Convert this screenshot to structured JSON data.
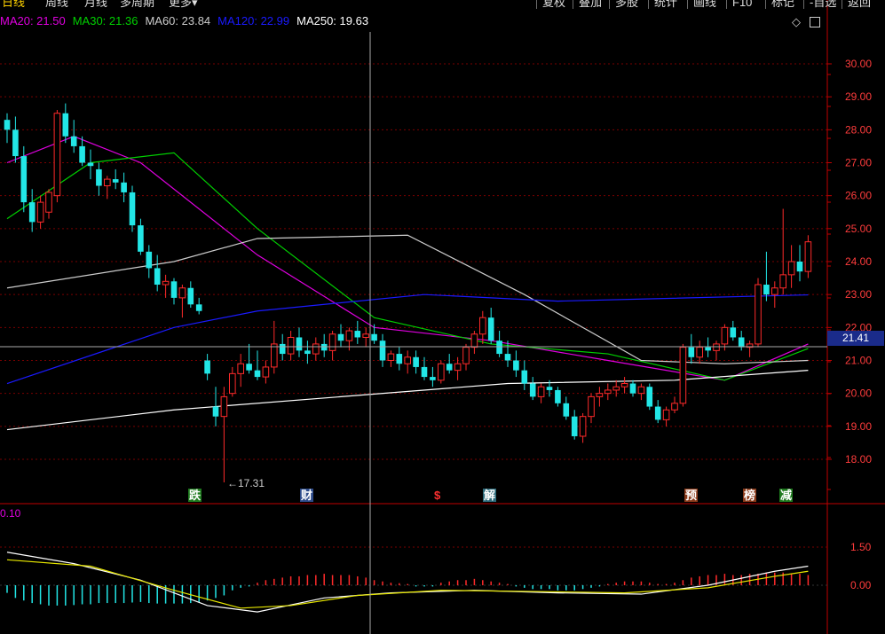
{
  "top_bar": {
    "period_tabs": [
      "日线",
      "周线",
      "月线",
      "多周期",
      "更多▾"
    ],
    "tools": [
      "复权",
      "叠加",
      "多股",
      "统计",
      "画线",
      "F10",
      "标记",
      "-自选",
      "返回"
    ]
  },
  "ma_legend": [
    {
      "label": "MA20: 21.50",
      "color": "#e000e0"
    },
    {
      "label": "MA30: 21.36",
      "color": "#00d000"
    },
    {
      "label": "MA60: 23.84",
      "color": "#cccccc"
    },
    {
      "label": "MA120: 22.99",
      "color": "#1a1aff"
    },
    {
      "label": "MA250: 19.63",
      "color": "#ffffff"
    }
  ],
  "price_axis": [
    "30.00",
    "29.00",
    "28.00",
    "27.00",
    "26.00",
    "25.00",
    "24.00",
    "23.00",
    "22.00",
    "21.00",
    "20.00",
    "19.00",
    "18.00"
  ],
  "crosshair_price": "21.41",
  "low_annotation": "17.31",
  "event_markers": [
    {
      "label": "跌",
      "bg": "#1e7a1e"
    },
    {
      "label": "财",
      "bg": "#2d4b8a"
    },
    {
      "label": "$",
      "bg": "#000000",
      "fg": "#ff3030"
    },
    {
      "label": "解",
      "bg": "#2c6a7a"
    },
    {
      "label": "预",
      "bg": "#8a3a1a"
    },
    {
      "label": "榜",
      "bg": "#8a3a1a"
    },
    {
      "label": "减",
      "bg": "#1e7a1e"
    }
  ],
  "macd_legend": "0.10",
  "macd_axis": [
    "1.50",
    "0.00"
  ],
  "colors": {
    "up": "#ff2a2a",
    "down": "#22e6e6",
    "grid": "#7a0000",
    "axis": "#c00000"
  },
  "chart_data": {
    "type": "candlestick",
    "ylim": [
      17.0,
      31.0
    ],
    "candles": [
      [
        28.3,
        28.5,
        27.6,
        28.0
      ],
      [
        28.0,
        28.4,
        27.0,
        27.2
      ],
      [
        27.2,
        27.5,
        25.5,
        25.8
      ],
      [
        25.8,
        26.2,
        24.9,
        25.2
      ],
      [
        25.2,
        26.0,
        25.0,
        25.8
      ],
      [
        25.5,
        26.2,
        25.3,
        26.1
      ],
      [
        26.0,
        28.6,
        25.8,
        28.5
      ],
      [
        28.5,
        28.8,
        27.6,
        27.8
      ],
      [
        27.8,
        28.3,
        27.3,
        27.5
      ],
      [
        27.5,
        27.8,
        26.9,
        27.0
      ],
      [
        27.0,
        27.4,
        26.5,
        26.9
      ],
      [
        26.8,
        27.0,
        26.0,
        26.3
      ],
      [
        26.3,
        26.6,
        25.9,
        26.5
      ],
      [
        26.5,
        26.8,
        26.2,
        26.4
      ],
      [
        26.4,
        26.7,
        25.8,
        26.1
      ],
      [
        26.1,
        26.3,
        24.9,
        25.1
      ],
      [
        25.1,
        25.3,
        24.2,
        24.3
      ],
      [
        24.3,
        24.5,
        23.5,
        23.8
      ],
      [
        23.8,
        24.2,
        23.1,
        23.3
      ],
      [
        23.3,
        23.6,
        22.9,
        23.4
      ],
      [
        23.4,
        23.5,
        22.7,
        22.9
      ],
      [
        22.9,
        23.3,
        22.3,
        23.2
      ],
      [
        23.2,
        23.4,
        22.6,
        22.7
      ],
      [
        22.7,
        22.9,
        22.4,
        22.5
      ],
      [
        21.0,
        21.2,
        20.4,
        20.6
      ],
      [
        19.6,
        20.2,
        19.0,
        19.3
      ],
      [
        19.3,
        20.2,
        17.3,
        19.9
      ],
      [
        20.0,
        20.8,
        19.9,
        20.6
      ],
      [
        20.6,
        21.2,
        20.2,
        20.9
      ],
      [
        20.9,
        21.5,
        20.6,
        20.7
      ],
      [
        20.7,
        21.3,
        20.4,
        20.5
      ],
      [
        20.5,
        21.0,
        20.3,
        20.8
      ],
      [
        20.8,
        22.2,
        20.6,
        21.5
      ],
      [
        21.5,
        21.8,
        21.0,
        21.2
      ],
      [
        21.2,
        21.9,
        21.0,
        21.7
      ],
      [
        21.7,
        22.0,
        21.1,
        21.3
      ],
      [
        21.3,
        21.6,
        20.9,
        21.2
      ],
      [
        21.2,
        21.7,
        21.0,
        21.5
      ],
      [
        21.5,
        21.8,
        21.1,
        21.3
      ],
      [
        21.3,
        21.9,
        21.0,
        21.8
      ],
      [
        21.8,
        22.1,
        21.4,
        21.6
      ],
      [
        21.6,
        22.0,
        21.3,
        21.9
      ],
      [
        21.9,
        22.2,
        21.5,
        21.7
      ],
      [
        21.7,
        22.0,
        21.4,
        21.8
      ],
      [
        21.8,
        22.1,
        21.5,
        21.6
      ],
      [
        21.6,
        21.8,
        20.8,
        21.0
      ],
      [
        21.0,
        21.3,
        20.8,
        21.2
      ],
      [
        21.2,
        21.4,
        20.7,
        20.9
      ],
      [
        20.9,
        21.3,
        20.6,
        21.1
      ],
      [
        21.1,
        21.3,
        20.6,
        20.8
      ],
      [
        20.8,
        21.1,
        20.4,
        20.5
      ],
      [
        20.5,
        20.8,
        20.2,
        20.4
      ],
      [
        20.4,
        21.0,
        20.3,
        20.9
      ],
      [
        20.9,
        21.2,
        20.6,
        20.7
      ],
      [
        20.7,
        21.1,
        20.4,
        20.9
      ],
      [
        20.9,
        21.5,
        20.7,
        21.4
      ],
      [
        21.4,
        21.9,
        21.2,
        21.8
      ],
      [
        21.8,
        22.5,
        21.5,
        22.3
      ],
      [
        22.3,
        22.6,
        21.5,
        21.6
      ],
      [
        21.6,
        21.9,
        21.1,
        21.2
      ],
      [
        21.2,
        21.6,
        20.8,
        21.0
      ],
      [
        21.0,
        21.3,
        20.5,
        20.7
      ],
      [
        20.7,
        21.0,
        20.1,
        20.3
      ],
      [
        20.3,
        20.5,
        19.8,
        19.9
      ],
      [
        19.9,
        20.3,
        19.7,
        20.2
      ],
      [
        20.2,
        20.4,
        19.9,
        20.1
      ],
      [
        20.1,
        20.2,
        19.6,
        19.7
      ],
      [
        19.7,
        19.9,
        19.2,
        19.3
      ],
      [
        19.3,
        19.5,
        18.6,
        18.7
      ],
      [
        18.7,
        19.4,
        18.5,
        19.3
      ],
      [
        19.3,
        20.0,
        19.1,
        19.9
      ],
      [
        19.9,
        20.2,
        19.6,
        20.0
      ],
      [
        20.0,
        20.3,
        19.8,
        20.1
      ],
      [
        20.1,
        20.4,
        19.9,
        20.2
      ],
      [
        20.2,
        20.5,
        20.0,
        20.3
      ],
      [
        20.3,
        20.4,
        19.9,
        20.0
      ],
      [
        20.0,
        20.3,
        19.8,
        20.2
      ],
      [
        20.2,
        20.3,
        19.5,
        19.6
      ],
      [
        19.6,
        19.8,
        19.1,
        19.2
      ],
      [
        19.2,
        19.6,
        19.0,
        19.5
      ],
      [
        19.5,
        19.9,
        19.4,
        19.7
      ],
      [
        19.7,
        21.5,
        19.6,
        21.4
      ],
      [
        21.4,
        21.8,
        20.9,
        21.1
      ],
      [
        21.1,
        21.6,
        20.9,
        21.4
      ],
      [
        21.4,
        21.7,
        21.1,
        21.3
      ],
      [
        21.3,
        21.6,
        21.0,
        21.5
      ],
      [
        21.5,
        22.1,
        21.3,
        22.0
      ],
      [
        22.0,
        22.2,
        21.6,
        21.7
      ],
      [
        21.7,
        21.9,
        21.3,
        21.4
      ],
      [
        21.4,
        21.6,
        21.1,
        21.5
      ],
      [
        21.5,
        23.5,
        21.4,
        23.3
      ],
      [
        23.3,
        24.3,
        22.8,
        23.0
      ],
      [
        23.0,
        23.4,
        22.6,
        23.2
      ],
      [
        23.2,
        25.6,
        23.0,
        23.6
      ],
      [
        23.6,
        24.5,
        23.2,
        24.0
      ],
      [
        24.0,
        24.5,
        23.4,
        23.7
      ],
      [
        23.7,
        24.8,
        23.5,
        24.6
      ]
    ],
    "ma_series": [
      {
        "name": "MA20",
        "color": "#e000e0",
        "points": [
          [
            0,
            27.0
          ],
          [
            8,
            27.8
          ],
          [
            16,
            27.0
          ],
          [
            30,
            24.2
          ],
          [
            44,
            22.0
          ],
          [
            58,
            21.6
          ],
          [
            72,
            21.0
          ],
          [
            86,
            20.4
          ],
          [
            96,
            21.5
          ]
        ]
      },
      {
        "name": "MA30",
        "color": "#00d000",
        "points": [
          [
            0,
            25.3
          ],
          [
            10,
            27.0
          ],
          [
            20,
            27.3
          ],
          [
            30,
            25.0
          ],
          [
            44,
            22.3
          ],
          [
            58,
            21.5
          ],
          [
            72,
            21.2
          ],
          [
            86,
            20.4
          ],
          [
            96,
            21.36
          ]
        ]
      },
      {
        "name": "MA60",
        "color": "#cccccc",
        "points": [
          [
            0,
            23.2
          ],
          [
            20,
            24.0
          ],
          [
            30,
            24.7
          ],
          [
            48,
            24.8
          ],
          [
            62,
            23.0
          ],
          [
            76,
            21.0
          ],
          [
            86,
            20.9
          ],
          [
            96,
            21.0
          ]
        ]
      },
      {
        "name": "MA120",
        "color": "#1a1aff",
        "points": [
          [
            0,
            20.3
          ],
          [
            20,
            22.0
          ],
          [
            30,
            22.5
          ],
          [
            50,
            23.0
          ],
          [
            66,
            22.8
          ],
          [
            96,
            22.99
          ]
        ]
      },
      {
        "name": "MA250",
        "color": "#ffffff",
        "points": [
          [
            0,
            18.9
          ],
          [
            20,
            19.5
          ],
          [
            40,
            19.9
          ],
          [
            60,
            20.3
          ],
          [
            80,
            20.4
          ],
          [
            96,
            20.7
          ]
        ]
      }
    ],
    "macd": {
      "ylim": [
        -1.1,
        2.0
      ],
      "hist": [
        -0.3,
        -0.5,
        -0.6,
        -0.7,
        -0.75,
        -0.8,
        -0.8,
        -0.8,
        -0.78,
        -0.75,
        -0.75,
        -0.7,
        -0.7,
        -0.7,
        -0.7,
        -0.68,
        -0.66,
        -0.7,
        -0.72,
        -0.72,
        -0.72,
        -0.72,
        -0.7,
        -0.68,
        -0.6,
        -0.5,
        -0.4,
        -0.2,
        -0.1,
        -0.05,
        0.1,
        0.2,
        0.25,
        0.3,
        0.35,
        0.35,
        0.4,
        0.4,
        0.45,
        0.4,
        0.4,
        0.4,
        0.35,
        0.3,
        0.2,
        0.15,
        0.1,
        0.08,
        0.05,
        -0.05,
        -0.05,
        -0.05,
        0.1,
        0.15,
        0.2,
        0.2,
        0.25,
        0.2,
        0.15,
        0.1,
        0.05,
        -0.05,
        -0.1,
        -0.15,
        -0.15,
        -0.15,
        -0.2,
        -0.2,
        -0.2,
        -0.15,
        -0.1,
        -0.05,
        0.05,
        0.1,
        0.15,
        0.15,
        0.15,
        0.1,
        0.05,
        0.05,
        0.1,
        0.2,
        0.3,
        0.35,
        0.4,
        0.4,
        0.45,
        0.4,
        0.4,
        0.45,
        0.45,
        0.5,
        0.5,
        0.5,
        0.45,
        0.45,
        0.4
      ],
      "dif": [
        [
          0,
          1.3
        ],
        [
          8,
          0.85
        ],
        [
          16,
          0.2
        ],
        [
          24,
          -0.8
        ],
        [
          30,
          -1.05
        ],
        [
          38,
          -0.5
        ],
        [
          46,
          -0.3
        ],
        [
          56,
          -0.2
        ],
        [
          66,
          -0.3
        ],
        [
          76,
          -0.35
        ],
        [
          84,
          0.0
        ],
        [
          92,
          0.55
        ],
        [
          96,
          0.75
        ]
      ],
      "dea": [
        [
          0,
          1.0
        ],
        [
          10,
          0.75
        ],
        [
          20,
          -0.2
        ],
        [
          28,
          -0.9
        ],
        [
          34,
          -0.8
        ],
        [
          42,
          -0.4
        ],
        [
          52,
          -0.2
        ],
        [
          64,
          -0.25
        ],
        [
          74,
          -0.3
        ],
        [
          84,
          -0.1
        ],
        [
          92,
          0.35
        ],
        [
          96,
          0.55
        ]
      ]
    }
  }
}
